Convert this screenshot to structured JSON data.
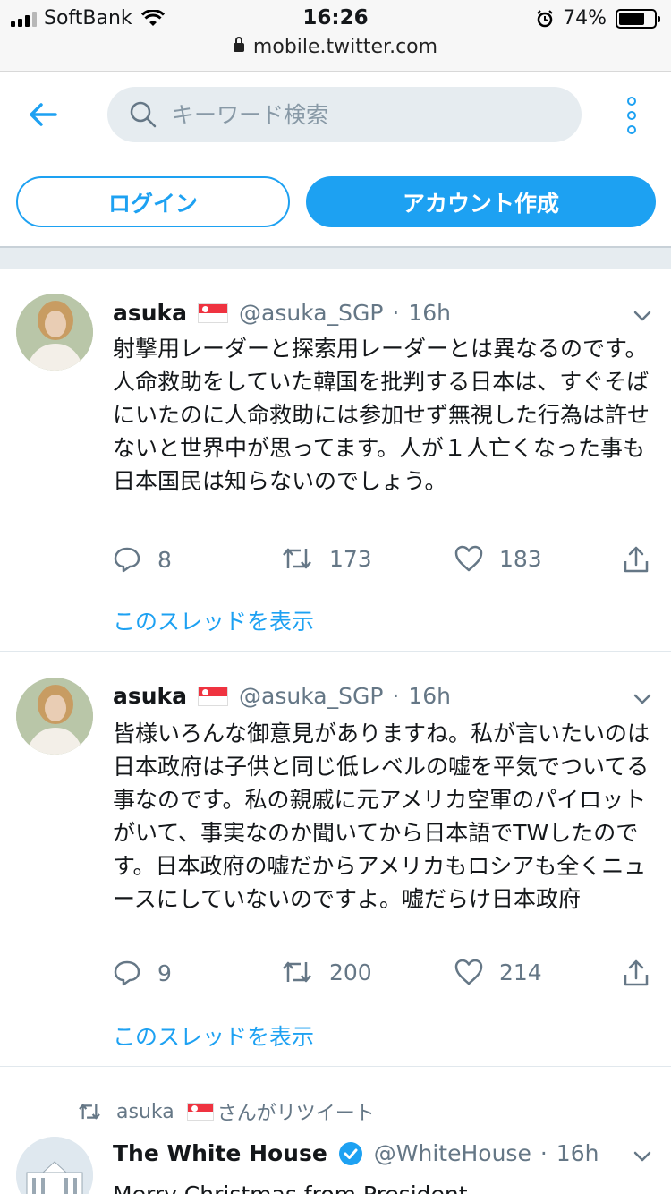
{
  "status_bar": {
    "carrier": "SoftBank",
    "time": "16:26",
    "battery": "74%",
    "battery_level": 0.74,
    "url": "mobile.twitter.com"
  },
  "header": {
    "search_placeholder": "キーワード検索",
    "login_label": "ログイン",
    "signup_label": "アカウント作成"
  },
  "tweets": [
    {
      "name": "asuka",
      "handle": "@asuka_SGP",
      "time": "16h",
      "text": "射撃用レーダーと探索用レーダーとは異なるのです。人命救助をしていた韓国を批判する日本は、すぐそばにいたのに人命救助には参加せず無視した行為は許せないと世界中が思ってます。人が１人亡くなった事も日本国民は知らないのでしょう。",
      "replies": "8",
      "retweets": "173",
      "likes": "183",
      "thread_link": "このスレッドを表示"
    },
    {
      "name": "asuka",
      "handle": "@asuka_SGP",
      "time": "16h",
      "text": "皆様いろんな御意見がありますね。私が言いたいのは日本政府は子供と同じ低レベルの嘘を平気でついてる事なのです。私の親戚に元アメリカ空軍のパイロットがいて、事実なのか聞いてから日本語でTWしたのです。日本政府の嘘だからアメリカもロシアも全くニュースにしていないのですよ。嘘だらけ日本政府",
      "replies": "9",
      "retweets": "200",
      "likes": "214",
      "thread_link": "このスレッドを表示"
    }
  ],
  "retweet_notice": {
    "user": "asuka",
    "suffix": "さんがリツイート"
  },
  "third_tweet": {
    "name": "The White House",
    "handle": "@WhiteHouse",
    "time": "16h",
    "text": "Merry Christmas from President"
  },
  "colors": {
    "accent": "#1da1f2",
    "secondary_text": "#657786"
  }
}
